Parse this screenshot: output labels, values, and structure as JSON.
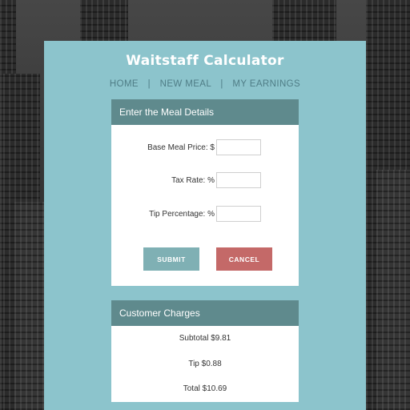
{
  "app": {
    "title": "Waitstaff Calculator"
  },
  "nav": {
    "items": [
      {
        "label": "HOME"
      },
      {
        "label": "NEW MEAL"
      },
      {
        "label": "MY EARNINGS"
      }
    ],
    "separator": "|"
  },
  "meal_form": {
    "heading": "Enter the Meal Details",
    "fields": [
      {
        "label": "Base Meal Price: $",
        "value": ""
      },
      {
        "label": "Tax Rate: %",
        "value": ""
      },
      {
        "label": "Tip Percentage: %",
        "value": ""
      }
    ],
    "submit_label": "SUBMIT",
    "cancel_label": "CANCEL"
  },
  "charges": {
    "heading": "Customer Charges",
    "subtotal": "Subtotal $9.81",
    "tip": "Tip $0.88",
    "total": "Total $10.69"
  },
  "colors": {
    "panel": "#8cc4cc",
    "header": "#5f8a8d",
    "submit": "#7fb0b4",
    "cancel": "#c46968"
  }
}
